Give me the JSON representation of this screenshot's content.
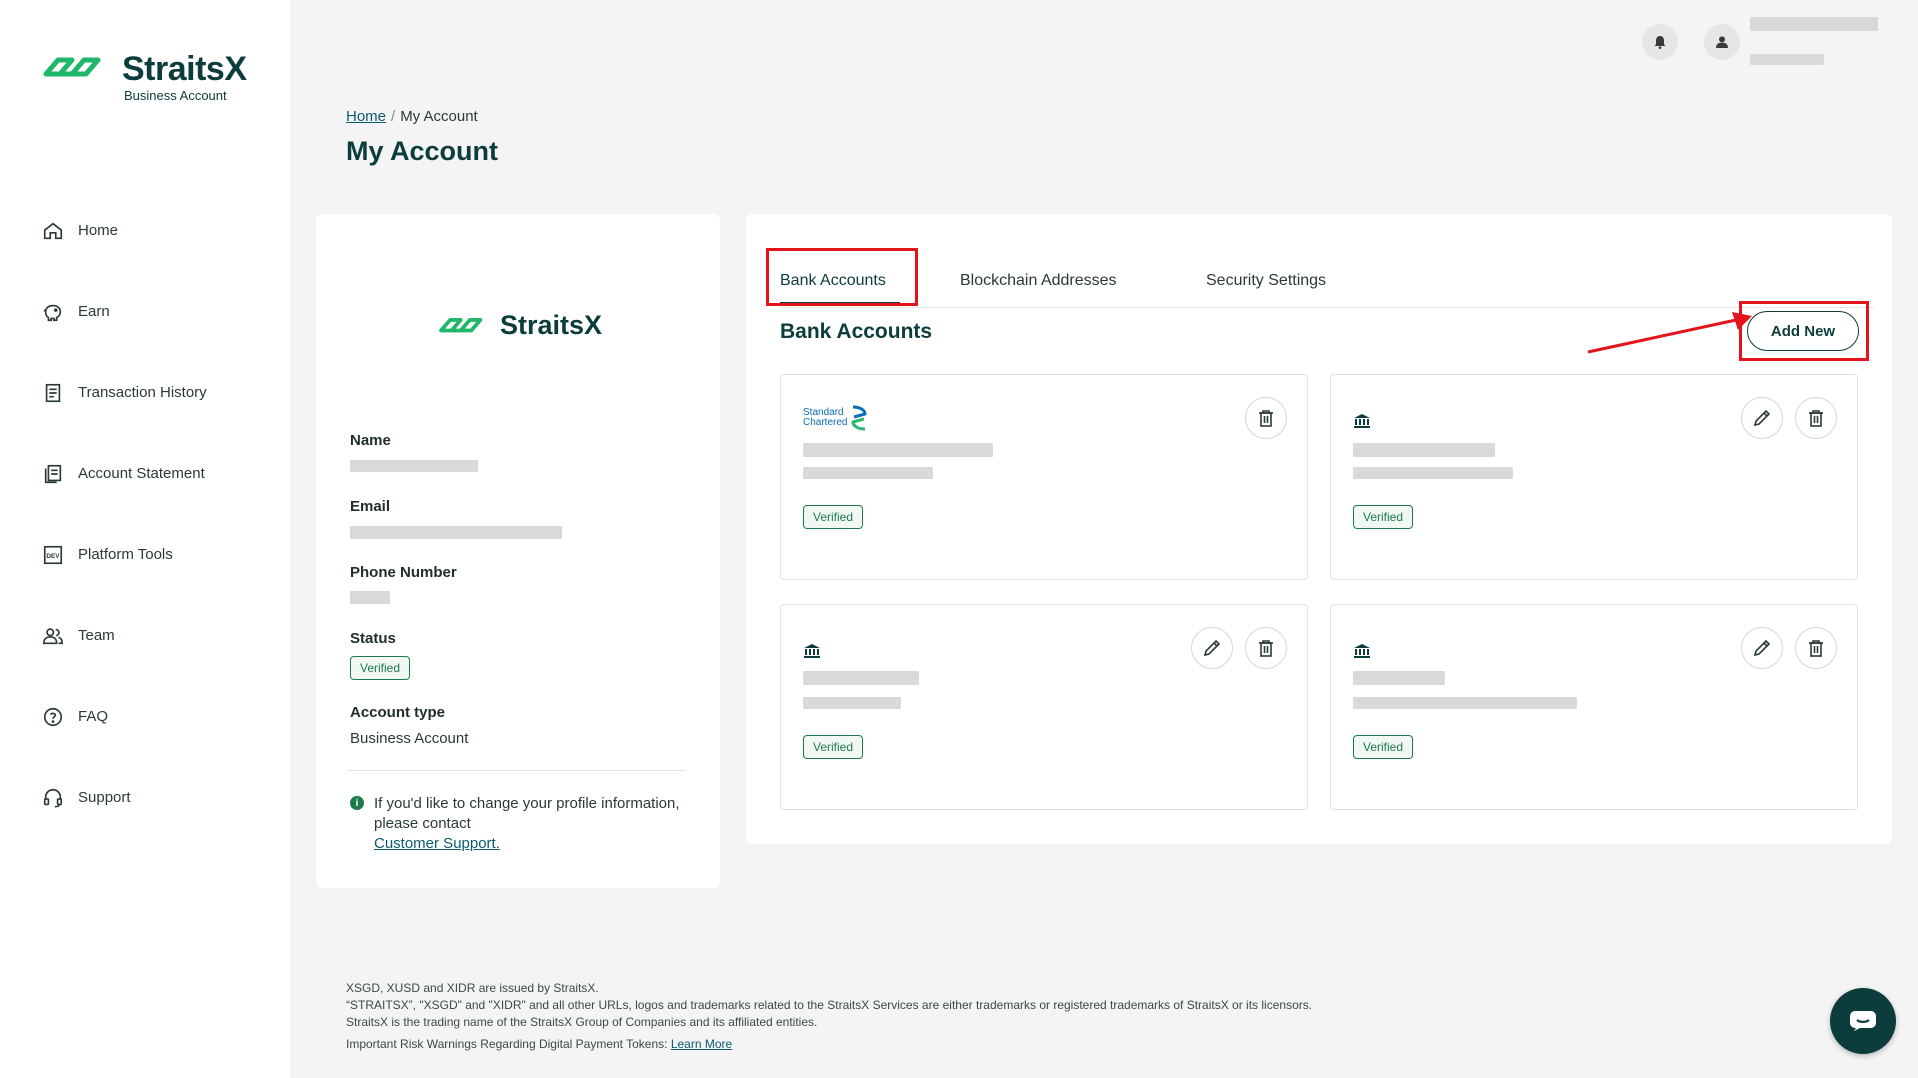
{
  "brand": {
    "name": "StraitsX",
    "subtitle": "Business Account",
    "primary_color": "#0c3c3c",
    "accent_color": "#1e7a4a"
  },
  "sidebar": {
    "items": [
      {
        "label": "Home",
        "icon": "home-icon"
      },
      {
        "label": "Earn",
        "icon": "piggy-bank-icon"
      },
      {
        "label": "Transaction History",
        "icon": "receipt-icon"
      },
      {
        "label": "Account Statement",
        "icon": "statement-icon"
      },
      {
        "label": "Platform Tools",
        "icon": "dev-icon"
      },
      {
        "label": "Team",
        "icon": "team-icon"
      },
      {
        "label": "FAQ",
        "icon": "question-icon"
      },
      {
        "label": "Support",
        "icon": "headset-icon"
      }
    ]
  },
  "header": {
    "breadcrumb": {
      "home": "Home",
      "separator": "/",
      "current": "My Account"
    },
    "title": "My Account"
  },
  "profile": {
    "logo_text": "StraitsX",
    "name_label": "Name",
    "email_label": "Email",
    "phone_label": "Phone Number",
    "status_label": "Status",
    "status_value": "Verified",
    "account_type_label": "Account type",
    "account_type_value": "Business Account",
    "info_text": "If you'd like to change your profile information, please contact",
    "info_link": "Customer Support."
  },
  "tabs": [
    {
      "label": "Bank Accounts",
      "active": true
    },
    {
      "label": "Blockchain Addresses",
      "active": false
    },
    {
      "label": "Security Settings",
      "active": false
    }
  ],
  "bank_section": {
    "title": "Bank Accounts",
    "add_new_label": "Add New",
    "cards": [
      {
        "bank_logo": "Standard Chartered",
        "logo_line1": "Standard",
        "logo_line2": "Chartered",
        "status": "Verified",
        "editable": false
      },
      {
        "bank_logo": "bank-icon",
        "status": "Verified",
        "editable": true
      },
      {
        "bank_logo": "bank-icon",
        "status": "Verified",
        "editable": true
      },
      {
        "bank_logo": "bank-icon",
        "status": "Verified",
        "editable": true
      }
    ]
  },
  "footer": {
    "line1": "XSGD, XUSD and XIDR are issued by StraitsX.",
    "line2": "“STRAITSX”, \"XSGD\" and \"XIDR\" and all other URLs, logos and trademarks related to the StraitsX Services are either trademarks or registered trademarks of StraitsX or its licensors.",
    "line3": "StraitsX is the trading name of the StraitsX Group of Companies and its affiliated entities.",
    "line4": "Important Risk Warnings Regarding Digital Payment Tokens:",
    "learn_more": "Learn More"
  }
}
